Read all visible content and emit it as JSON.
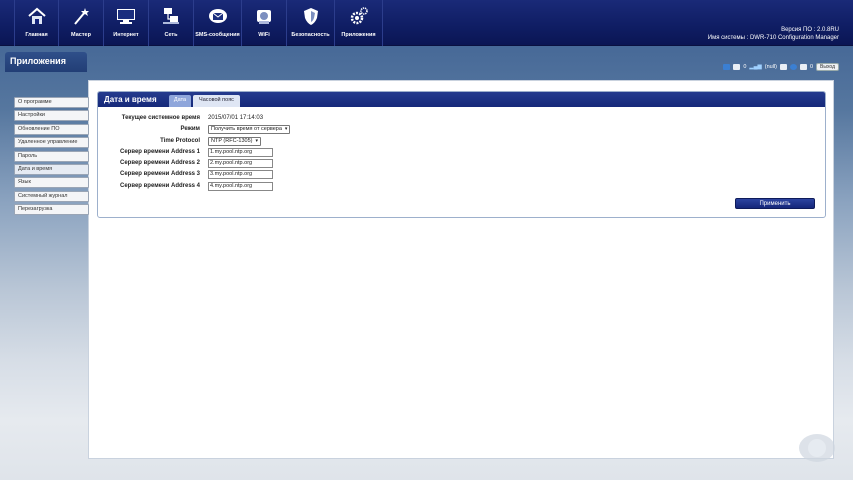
{
  "nav": {
    "items": [
      {
        "label": "Главная",
        "icon": "home-icon"
      },
      {
        "label": "Мастер",
        "icon": "wizard-icon"
      },
      {
        "label": "Интернет",
        "icon": "internet-icon"
      },
      {
        "label": "Сеть",
        "icon": "network-icon"
      },
      {
        "label": "SMS-сообщения",
        "icon": "sms-icon"
      },
      {
        "label": "WiFi",
        "icon": "wifi-icon"
      },
      {
        "label": "Безопасность",
        "icon": "shield-icon"
      },
      {
        "label": "Приложения",
        "icon": "apps-gear-icon"
      }
    ]
  },
  "sysinfo": {
    "line1": "Версия ПО : 2.0.8RU",
    "line2": "Имя системы : DWR-710 Configuration Manager"
  },
  "status": {
    "sms_count": "0",
    "signal": "(null)",
    "users_count": "0",
    "logout_label": "Выход"
  },
  "apps_title": "Приложения",
  "sidebar": {
    "items": [
      "О программе",
      "Настройки",
      "Обновление ПО",
      "Удаленное управление",
      "Пароль",
      "Дата и время",
      "Язык",
      "Системный журнал",
      "Перезагрузка"
    ]
  },
  "card": {
    "title": "Дата и время",
    "tabs": [
      "Дата",
      "Часовой пояс"
    ]
  },
  "form": {
    "current_time_label": "Текущее системное время",
    "current_time_value": "2015/07/01 17:14:03",
    "mode_label": "Режим",
    "mode_value": "Получить время от сервера",
    "protocol_label": "Time Protocol",
    "protocol_value": "NTP (RFC-1305)",
    "server1_label": "Сервер времени Address 1",
    "server1_value": "1.my.pool.ntp.org",
    "server2_label": "Сервер времени Address 2",
    "server2_value": "2.my.pool.ntp.org",
    "server3_label": "Сервер времени Address 3",
    "server3_value": "3.my.pool.ntp.org",
    "server4_label": "Сервер времени Address 4",
    "server4_value": "4.my.pool.ntp.org",
    "apply_label": "Применить"
  },
  "colors": {
    "nav_bg": "#13227a",
    "accent": "#253b8e",
    "tab_active": "#8fa6db"
  }
}
